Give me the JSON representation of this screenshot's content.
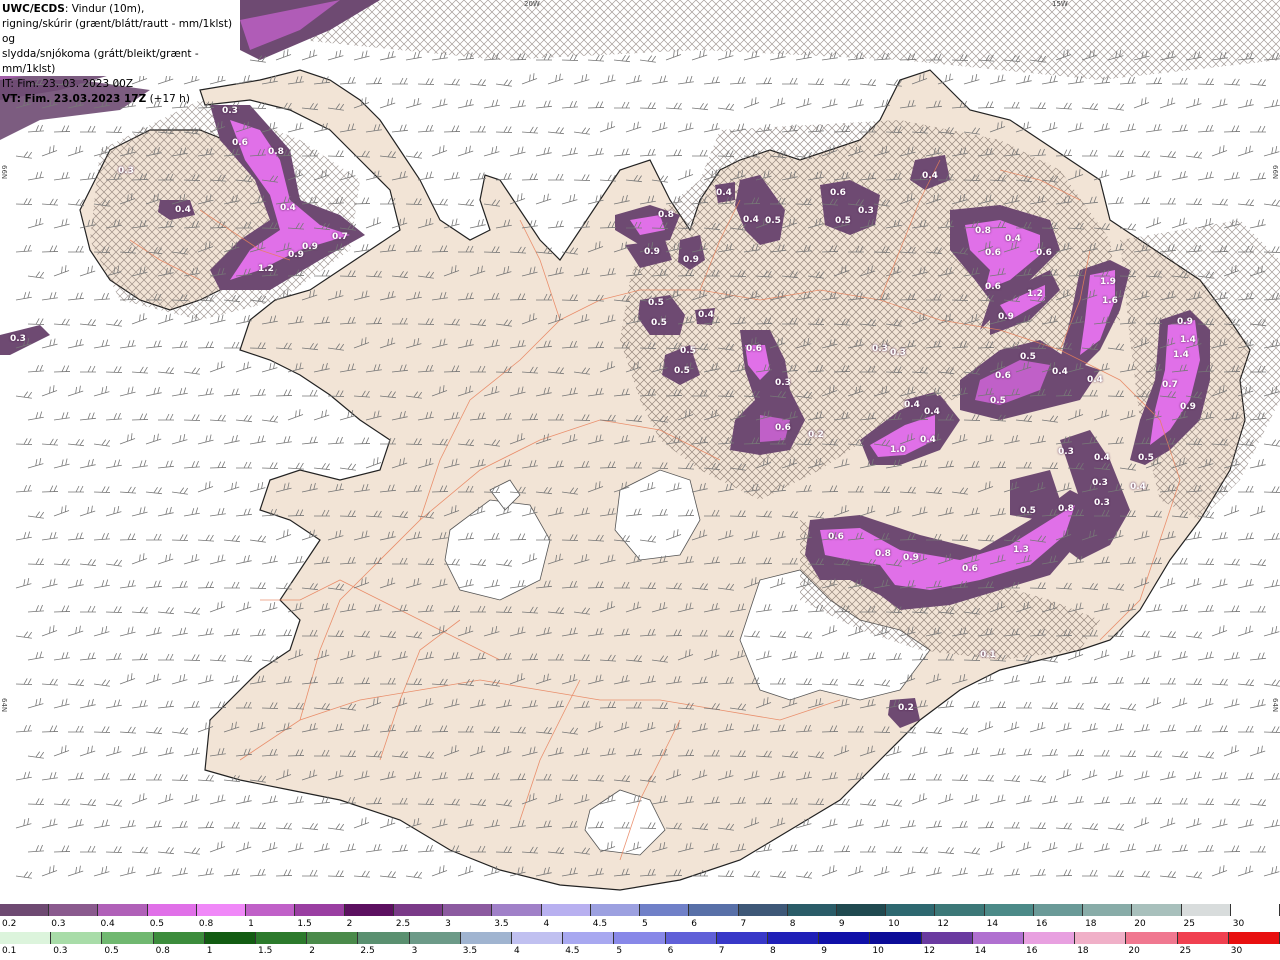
{
  "header": {
    "model": "UWC/ECDS",
    "line1": ": Vindur (10m),",
    "line2": "rigning/skúrir (grænt/blátt/rautt - mm/1klst) og",
    "line3": "slydda/snjókoma (grátt/bleikt/grænt - mm/1klst)",
    "issue_time": "IT: Fim. 23. 03. 2023 00Z",
    "valid_label": "VT: Fim. 23.03.2023 17Z",
    "valid_offset": " (+17 h)"
  },
  "coordinates": {
    "top_20w": "20W",
    "top_15w": "15W",
    "left_66n": "66N",
    "right_66n": "66N",
    "left_64n": "64N",
    "right_64n": "64N"
  },
  "cell_values": [
    "0.3",
    "0.6",
    "0.8",
    "0.4",
    "0.3",
    "0.4",
    "0.9",
    "0.7",
    "1.2",
    "0.9",
    "0.3",
    "0.8",
    "0.9",
    "0.9",
    "0.5",
    "0.5",
    "0.4",
    "0.5",
    "0.5",
    "0.6",
    "0.3",
    "0.6",
    "0.2",
    "0.4",
    "0.4",
    "0.5",
    "0.6",
    "0.5",
    "0.3",
    "0.4",
    "0.8",
    "0.4",
    "0.6",
    "0.6",
    "1.2",
    "0.6",
    "0.9",
    "1.9",
    "1.6",
    "0.5",
    "0.6",
    "0.4",
    "0.4",
    "0.5",
    "0.3",
    "0.3",
    "0.4",
    "0.4",
    "0.4",
    "1.0",
    "0.9",
    "1.4",
    "1.4",
    "0.7",
    "0.9",
    "0.5",
    "0.4",
    "0.3",
    "0.4",
    "0.3",
    "0.5",
    "0.8",
    "0.3",
    "0.6",
    "0.8",
    "0.9",
    "0.6",
    "1.3",
    "0.1",
    "0.2"
  ],
  "scale_snow": {
    "labels": [
      "0.2",
      "0.3",
      "0.4",
      "0.5",
      "0.8",
      "1",
      "1.5",
      "2",
      "2.5",
      "3",
      "3.5",
      "4",
      "4.5",
      "5",
      "6",
      "7",
      "8",
      "9",
      "10",
      "12",
      "14",
      "16",
      "18",
      "20",
      "25",
      "30"
    ],
    "colors": [
      "#6e4a72",
      "#8a5a8e",
      "#b060b8",
      "#e070e8",
      "#f088f8",
      "#c060c8",
      "#9a3ea2",
      "#5c1060",
      "#7a3a88",
      "#8c5aa0",
      "#a080c8",
      "#b8b0f0",
      "#9ca0e0",
      "#7080c8",
      "#5870a8",
      "#3e5878",
      "#2a5c68",
      "#204a50",
      "#2e6870",
      "#3c7878",
      "#4c8a88",
      "#6a9a98",
      "#88aca8",
      "#a8c0bc",
      "#d8dcdc",
      "#ffffff"
    ]
  },
  "scale_rain": {
    "labels": [
      "0.1",
      "0.3",
      "0.5",
      "0.8",
      "1",
      "1.5",
      "2",
      "2.5",
      "3",
      "3.5",
      "4",
      "4.5",
      "5",
      "6",
      "7",
      "8",
      "9",
      "10",
      "12",
      "14",
      "16",
      "18",
      "20",
      "25",
      "30"
    ],
    "colors": [
      "#dcf4dc",
      "#a8dca8",
      "#70b870",
      "#3c8c3c",
      "#125c12",
      "#2c7a2c",
      "#4a8a4a",
      "#5a9070",
      "#6c9a88",
      "#a0b4d0",
      "#c0c0f0",
      "#a8a8f0",
      "#8888e8",
      "#6060d8",
      "#3838c8",
      "#2020b8",
      "#1010a8",
      "#0c0c98",
      "#6a3aa0",
      "#b070d0",
      "#e8a0e0",
      "#f0b0c8",
      "#f07890",
      "#f04050",
      "#e81010"
    ]
  }
}
